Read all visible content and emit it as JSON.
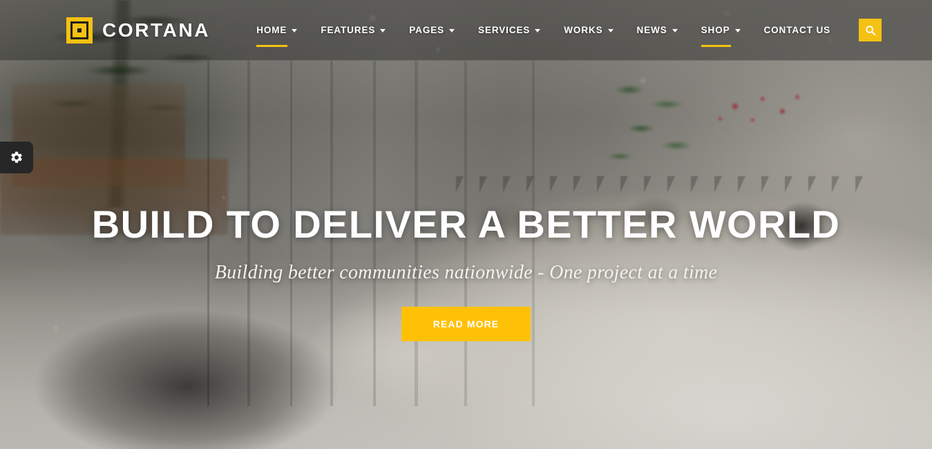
{
  "header": {
    "brand": {
      "name": "CORTANA",
      "logo_icon": "concentric-square-logo-icon",
      "accent_color": "#F5C112"
    },
    "nav": [
      {
        "label": "HOME",
        "has_dropdown": true,
        "active": true
      },
      {
        "label": "FEATURES",
        "has_dropdown": true,
        "active": false
      },
      {
        "label": "PAGES",
        "has_dropdown": true,
        "active": false
      },
      {
        "label": "SERVICES",
        "has_dropdown": true,
        "active": false
      },
      {
        "label": "WORKS",
        "has_dropdown": true,
        "active": false
      },
      {
        "label": "NEWS",
        "has_dropdown": true,
        "active": false
      },
      {
        "label": "SHOP",
        "has_dropdown": true,
        "active": true
      },
      {
        "label": "CONTACT US",
        "has_dropdown": false,
        "active": false
      }
    ],
    "search": {
      "icon": "search-icon",
      "background_color": "#F5C112"
    }
  },
  "settings_tab": {
    "icon": "gear-icon",
    "background_color": "#262626"
  },
  "hero": {
    "title": "BUILD TO DELIVER A BETTER WORLD",
    "subtitle": "Building better communities nationwide - One project at a time",
    "cta_label": "READ MORE",
    "cta_color": "#FFC107"
  }
}
